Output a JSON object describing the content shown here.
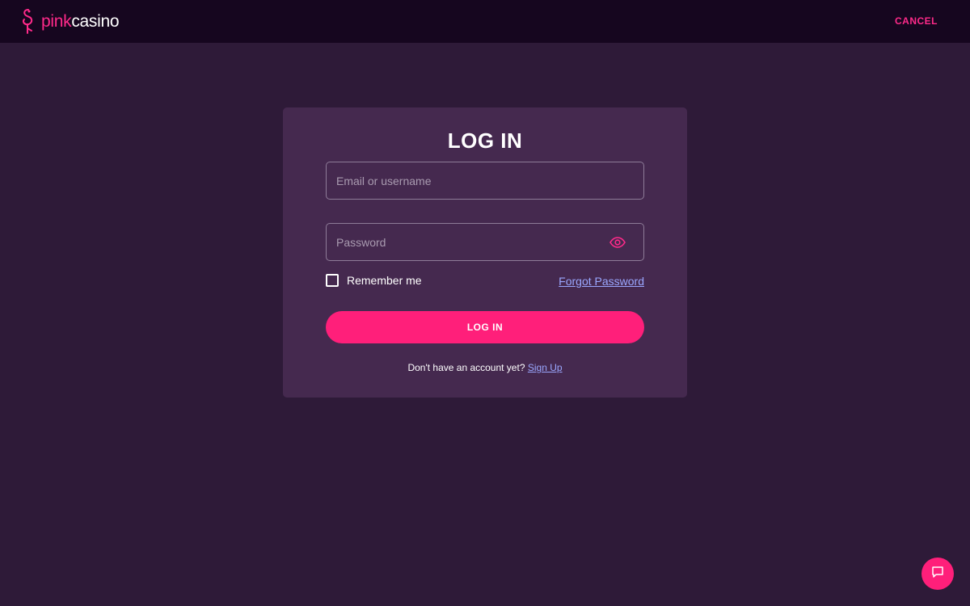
{
  "header": {
    "logo_part1": "pink",
    "logo_part2": "casino",
    "cancel_label": "CANCEL"
  },
  "login": {
    "title": "LOG IN",
    "email_placeholder": "Email or username",
    "password_placeholder": "Password",
    "remember_label": "Remember me",
    "forgot_label": "Forgot Password",
    "submit_label": "LOG IN",
    "signup_prompt": "Don't have an account yet?",
    "signup_label": "Sign Up"
  },
  "icons": {
    "logo": "flamingo-icon",
    "password_toggle": "eye-icon",
    "chat": "chat-icon"
  },
  "colors": {
    "accent": "#ff1f7a",
    "link": "#9aa7ff",
    "background": "#2e1a38",
    "card": "#45294f",
    "header": "#16061f"
  }
}
